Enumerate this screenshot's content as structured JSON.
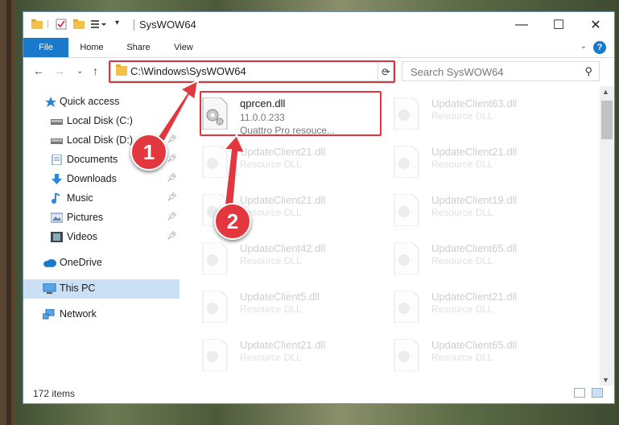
{
  "window": {
    "title": "SysWOW64",
    "minimize": "—",
    "maximize": "☐",
    "close": "✕"
  },
  "ribbon": {
    "tabs": [
      "File",
      "Home",
      "Share",
      "View"
    ],
    "help": "?"
  },
  "address": {
    "path": "C:\\Windows\\SysWOW64",
    "search_placeholder": "Search SysWOW64"
  },
  "sidebar": {
    "items": [
      {
        "label": "Quick access",
        "icon": "star-icon"
      },
      {
        "label": "Local Disk (C:)",
        "icon": "drive-icon",
        "pinned": true
      },
      {
        "label": "Local Disk (D:)",
        "icon": "drive-icon",
        "pinned": true
      },
      {
        "label": "Documents",
        "icon": "documents-icon",
        "pinned": true
      },
      {
        "label": "Downloads",
        "icon": "downloads-icon",
        "pinned": true
      },
      {
        "label": "Music",
        "icon": "music-icon",
        "pinned": true
      },
      {
        "label": "Pictures",
        "icon": "pictures-icon",
        "pinned": true
      },
      {
        "label": "Videos",
        "icon": "videos-icon",
        "pinned": true
      },
      {
        "label": "OneDrive",
        "icon": "onedrive-icon"
      },
      {
        "label": "This PC",
        "icon": "pc-icon",
        "selected": true
      },
      {
        "label": "Network",
        "icon": "network-icon"
      }
    ]
  },
  "files": {
    "highlighted": {
      "name": "qprcen.dll",
      "version": "11.0.0.233",
      "description": "Quattro Pro resouce..."
    },
    "left_column": [
      {
        "name": "UpdateClient21.dll",
        "description": "Resource DLL"
      },
      {
        "name": "UpdateClient21.dll",
        "description": "Resource DLL"
      },
      {
        "name": "UpdateClient42.dll",
        "description": "Resource DLL"
      },
      {
        "name": "UpdateClient5.dll",
        "description": "Resource DLL"
      },
      {
        "name": "UpdateClient21.dll",
        "description": "Resource DLL"
      }
    ],
    "right_column": [
      {
        "name": "UpdateClient63.dll",
        "description": "Resource DLL"
      },
      {
        "name": "UpdateClient21.dll",
        "description": "Resource DLL"
      },
      {
        "name": "UpdateClient19.dll",
        "description": "Resource DLL"
      },
      {
        "name": "UpdateClient65.dll",
        "description": "Resource DLL"
      },
      {
        "name": "UpdateClient21.dll",
        "description": "Resource DLL"
      },
      {
        "name": "UpdateClient65.dll",
        "description": "Resource DLL"
      }
    ]
  },
  "status": {
    "item_count": "172 items"
  },
  "annotations": {
    "step1": "1",
    "step2": "2",
    "highlight_color": "#e0333b"
  }
}
